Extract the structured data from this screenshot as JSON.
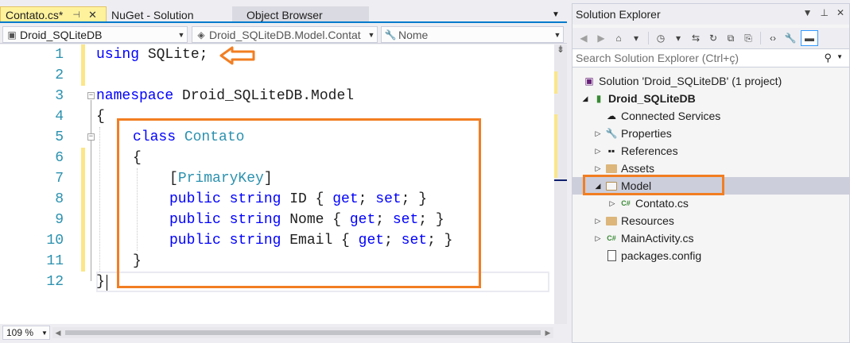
{
  "editor": {
    "tabs": [
      {
        "label": "Contato.cs*",
        "active": true
      },
      {
        "label": "NuGet - Solution",
        "active": false
      },
      {
        "label": "Object Browser",
        "active": false
      }
    ],
    "nav": {
      "project": "Droid_SQLiteDB",
      "type": "Droid_SQLiteDB.Model.Contat",
      "member": "Nome"
    },
    "line_numbers": [
      "1",
      "2",
      "3",
      "4",
      "5",
      "6",
      "7",
      "8",
      "9",
      "10",
      "11",
      "12"
    ],
    "code": {
      "l1": {
        "kw": "using",
        "rest": " SQLite;"
      },
      "l3": {
        "kw": "namespace",
        "rest": " Droid_SQLiteDB.Model"
      },
      "l4": "{",
      "l5": {
        "kw": "class",
        "type": "Contato"
      },
      "l6": "{",
      "l7": {
        "open": "[",
        "attr": "PrimaryKey",
        "close": "]"
      },
      "l8": {
        "kw1": "public",
        "kw2": "string",
        "name": " ID { ",
        "get": "get",
        "mid": "; ",
        "set": "set",
        "end": "; }"
      },
      "l9": {
        "kw1": "public",
        "kw2": "string",
        "name": " Nome { ",
        "get": "get",
        "mid": "; ",
        "set": "set",
        "end": "; }"
      },
      "l10": {
        "kw1": "public",
        "kw2": "string",
        "name": " Email { ",
        "get": "get",
        "mid": "; ",
        "set": "set",
        "end": "; }"
      },
      "l11": "}",
      "l12": "}"
    },
    "zoom": "109 %"
  },
  "solution_explorer": {
    "title": "Solution Explorer",
    "search_placeholder": "Search Solution Explorer (Ctrl+ç)",
    "tree": {
      "solution": "Solution 'Droid_SQLiteDB' (1 project)",
      "project": "Droid_SQLiteDB",
      "connected": "Connected Services",
      "properties": "Properties",
      "references": "References",
      "assets": "Assets",
      "model": "Model",
      "contato": "Contato.cs",
      "resources": "Resources",
      "mainactivity": "MainActivity.cs",
      "packages": "packages.config"
    }
  },
  "colors": {
    "accent": "#007ACC",
    "annotation": "#F27E22",
    "keyword": "#0000FF",
    "type": "#2B91AF",
    "active_tab": "#FFF29D"
  }
}
